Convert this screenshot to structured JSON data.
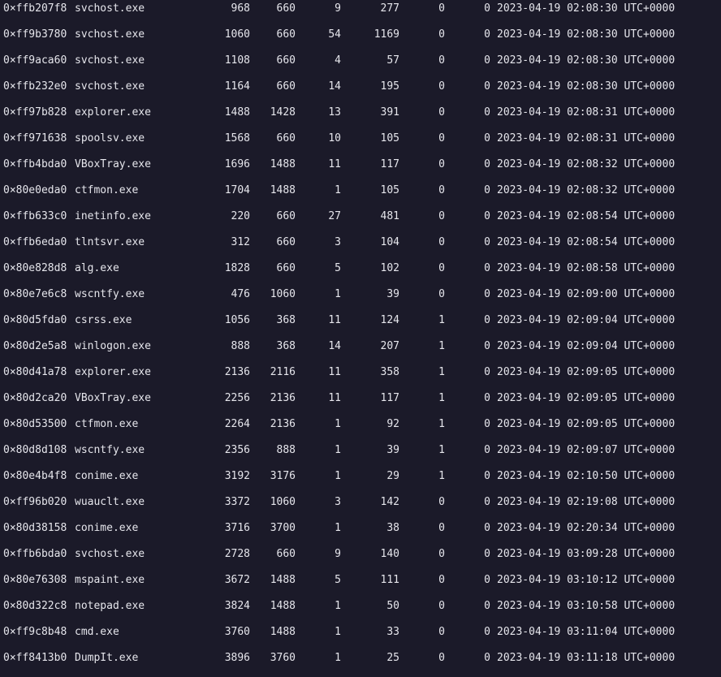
{
  "colors": {
    "background": "#1b1a29",
    "text": "#e6e6ec"
  },
  "process_list": {
    "rows": [
      {
        "offset": "0×ffb207f8",
        "name": "svchost.exe",
        "pid": "968",
        "ppid": "660",
        "threads": "9",
        "handles": "277",
        "session": "0",
        "wow64": "0",
        "time": "2023-04-19 02:08:30 UTC+0000"
      },
      {
        "offset": "0×ff9b3780",
        "name": "svchost.exe",
        "pid": "1060",
        "ppid": "660",
        "threads": "54",
        "handles": "1169",
        "session": "0",
        "wow64": "0",
        "time": "2023-04-19 02:08:30 UTC+0000"
      },
      {
        "offset": "0×ff9aca60",
        "name": "svchost.exe",
        "pid": "1108",
        "ppid": "660",
        "threads": "4",
        "handles": "57",
        "session": "0",
        "wow64": "0",
        "time": "2023-04-19 02:08:30 UTC+0000"
      },
      {
        "offset": "0×ffb232e0",
        "name": "svchost.exe",
        "pid": "1164",
        "ppid": "660",
        "threads": "14",
        "handles": "195",
        "session": "0",
        "wow64": "0",
        "time": "2023-04-19 02:08:30 UTC+0000"
      },
      {
        "offset": "0×ff97b828",
        "name": "explorer.exe",
        "pid": "1488",
        "ppid": "1428",
        "threads": "13",
        "handles": "391",
        "session": "0",
        "wow64": "0",
        "time": "2023-04-19 02:08:31 UTC+0000"
      },
      {
        "offset": "0×ff971638",
        "name": "spoolsv.exe",
        "pid": "1568",
        "ppid": "660",
        "threads": "10",
        "handles": "105",
        "session": "0",
        "wow64": "0",
        "time": "2023-04-19 02:08:31 UTC+0000"
      },
      {
        "offset": "0×ffb4bda0",
        "name": "VBoxTray.exe",
        "pid": "1696",
        "ppid": "1488",
        "threads": "11",
        "handles": "117",
        "session": "0",
        "wow64": "0",
        "time": "2023-04-19 02:08:32 UTC+0000"
      },
      {
        "offset": "0×80e0eda0",
        "name": "ctfmon.exe",
        "pid": "1704",
        "ppid": "1488",
        "threads": "1",
        "handles": "105",
        "session": "0",
        "wow64": "0",
        "time": "2023-04-19 02:08:32 UTC+0000"
      },
      {
        "offset": "0×ffb633c0",
        "name": "inetinfo.exe",
        "pid": "220",
        "ppid": "660",
        "threads": "27",
        "handles": "481",
        "session": "0",
        "wow64": "0",
        "time": "2023-04-19 02:08:54 UTC+0000"
      },
      {
        "offset": "0×ffb6eda0",
        "name": "tlntsvr.exe",
        "pid": "312",
        "ppid": "660",
        "threads": "3",
        "handles": "104",
        "session": "0",
        "wow64": "0",
        "time": "2023-04-19 02:08:54 UTC+0000"
      },
      {
        "offset": "0×80e828d8",
        "name": "alg.exe",
        "pid": "1828",
        "ppid": "660",
        "threads": "5",
        "handles": "102",
        "session": "0",
        "wow64": "0",
        "time": "2023-04-19 02:08:58 UTC+0000"
      },
      {
        "offset": "0×80e7e6c8",
        "name": "wscntfy.exe",
        "pid": "476",
        "ppid": "1060",
        "threads": "1",
        "handles": "39",
        "session": "0",
        "wow64": "0",
        "time": "2023-04-19 02:09:00 UTC+0000"
      },
      {
        "offset": "0×80d5fda0",
        "name": "csrss.exe",
        "pid": "1056",
        "ppid": "368",
        "threads": "11",
        "handles": "124",
        "session": "1",
        "wow64": "0",
        "time": "2023-04-19 02:09:04 UTC+0000"
      },
      {
        "offset": "0×80d2e5a8",
        "name": "winlogon.exe",
        "pid": "888",
        "ppid": "368",
        "threads": "14",
        "handles": "207",
        "session": "1",
        "wow64": "0",
        "time": "2023-04-19 02:09:04 UTC+0000"
      },
      {
        "offset": "0×80d41a78",
        "name": "explorer.exe",
        "pid": "2136",
        "ppid": "2116",
        "threads": "11",
        "handles": "358",
        "session": "1",
        "wow64": "0",
        "time": "2023-04-19 02:09:05 UTC+0000"
      },
      {
        "offset": "0×80d2ca20",
        "name": "VBoxTray.exe",
        "pid": "2256",
        "ppid": "2136",
        "threads": "11",
        "handles": "117",
        "session": "1",
        "wow64": "0",
        "time": "2023-04-19 02:09:05 UTC+0000"
      },
      {
        "offset": "0×80d53500",
        "name": "ctfmon.exe",
        "pid": "2264",
        "ppid": "2136",
        "threads": "1",
        "handles": "92",
        "session": "1",
        "wow64": "0",
        "time": "2023-04-19 02:09:05 UTC+0000"
      },
      {
        "offset": "0×80d8d108",
        "name": "wscntfy.exe",
        "pid": "2356",
        "ppid": "888",
        "threads": "1",
        "handles": "39",
        "session": "1",
        "wow64": "0",
        "time": "2023-04-19 02:09:07 UTC+0000"
      },
      {
        "offset": "0×80e4b4f8",
        "name": "conime.exe",
        "pid": "3192",
        "ppid": "3176",
        "threads": "1",
        "handles": "29",
        "session": "1",
        "wow64": "0",
        "time": "2023-04-19 02:10:50 UTC+0000"
      },
      {
        "offset": "0×ff96b020",
        "name": "wuauclt.exe",
        "pid": "3372",
        "ppid": "1060",
        "threads": "3",
        "handles": "142",
        "session": "0",
        "wow64": "0",
        "time": "2023-04-19 02:19:08 UTC+0000"
      },
      {
        "offset": "0×80d38158",
        "name": "conime.exe",
        "pid": "3716",
        "ppid": "3700",
        "threads": "1",
        "handles": "38",
        "session": "0",
        "wow64": "0",
        "time": "2023-04-19 02:20:34 UTC+0000"
      },
      {
        "offset": "0×ffb6bda0",
        "name": "svchost.exe",
        "pid": "2728",
        "ppid": "660",
        "threads": "9",
        "handles": "140",
        "session": "0",
        "wow64": "0",
        "time": "2023-04-19 03:09:28 UTC+0000"
      },
      {
        "offset": "0×80e76308",
        "name": "mspaint.exe",
        "pid": "3672",
        "ppid": "1488",
        "threads": "5",
        "handles": "111",
        "session": "0",
        "wow64": "0",
        "time": "2023-04-19 03:10:12 UTC+0000"
      },
      {
        "offset": "0×80d322c8",
        "name": "notepad.exe",
        "pid": "3824",
        "ppid": "1488",
        "threads": "1",
        "handles": "50",
        "session": "0",
        "wow64": "0",
        "time": "2023-04-19 03:10:58 UTC+0000"
      },
      {
        "offset": "0×ff9c8b48",
        "name": "cmd.exe",
        "pid": "3760",
        "ppid": "1488",
        "threads": "1",
        "handles": "33",
        "session": "0",
        "wow64": "0",
        "time": "2023-04-19 03:11:04 UTC+0000"
      },
      {
        "offset": "0×ff8413b0",
        "name": "DumpIt.exe",
        "pid": "3896",
        "ppid": "3760",
        "threads": "1",
        "handles": "25",
        "session": "0",
        "wow64": "0",
        "time": "2023-04-19 03:11:18 UTC+0000"
      }
    ]
  }
}
